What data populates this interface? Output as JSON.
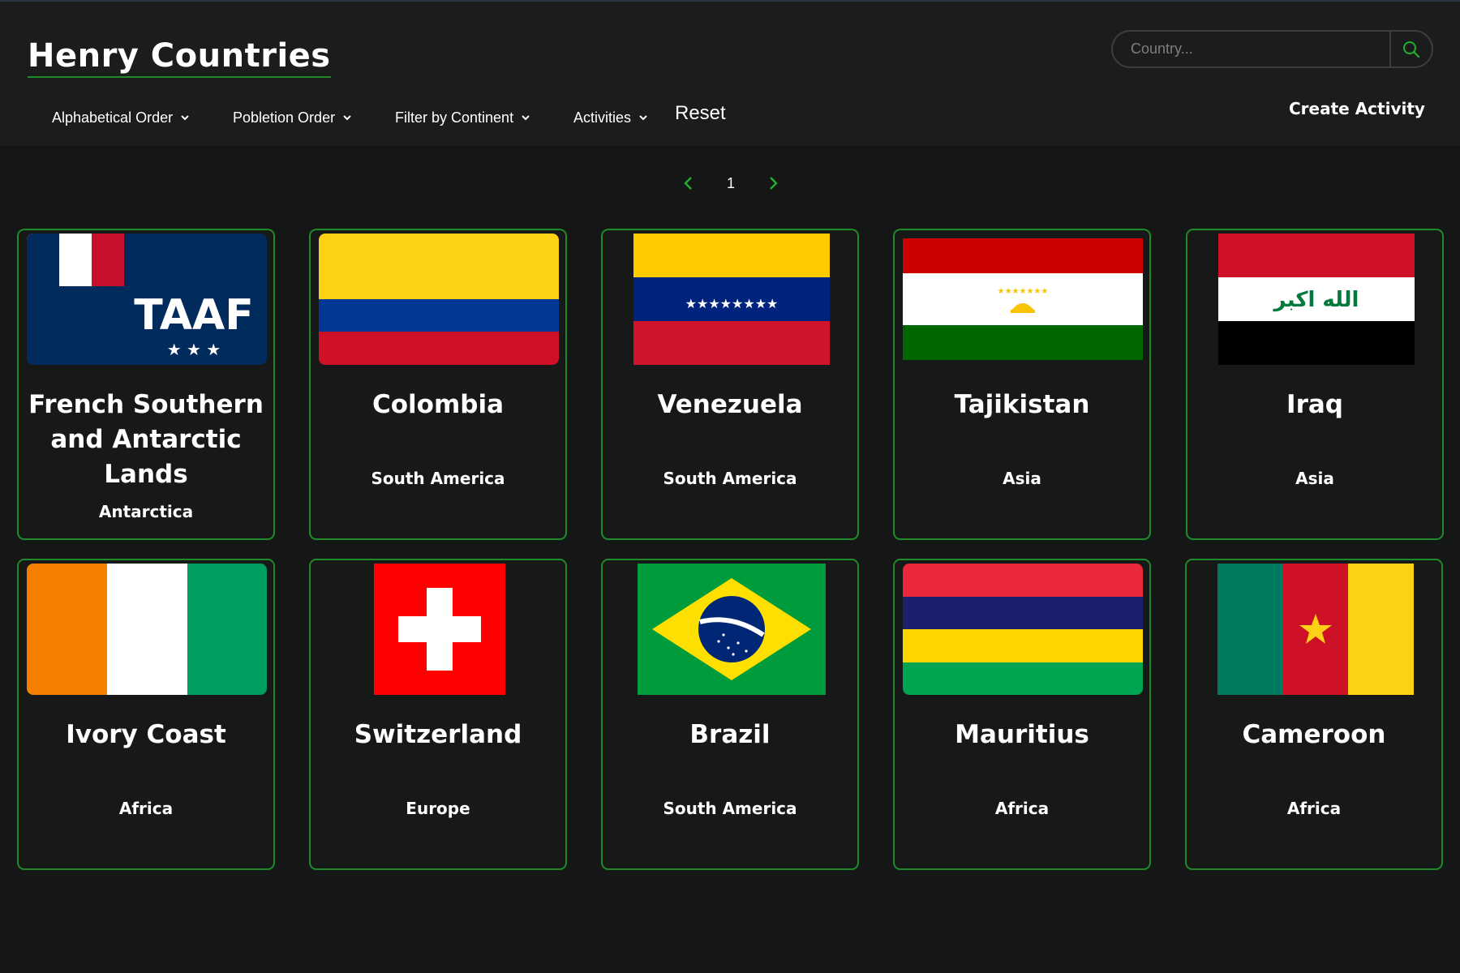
{
  "header": {
    "title": "Henry Countries",
    "nav": [
      {
        "label": "Alphabetical Order"
      },
      {
        "label": "Pobletion Order"
      },
      {
        "label": "Filter by Continent"
      },
      {
        "label": "Activities"
      }
    ],
    "reset_label": "Reset",
    "create_label": "Create Activity",
    "search": {
      "placeholder": "Country..."
    }
  },
  "pagination": {
    "current": "1"
  },
  "colors": {
    "accent": "#1f8a2a",
    "background": "#151716",
    "header": "#1b1c1c"
  },
  "countries": [
    {
      "name_lines": [
        "French Southern",
        "and Antarctic Lands"
      ],
      "continent": "Antarctica"
    },
    {
      "name_lines": [
        "Colombia"
      ],
      "continent": "South America"
    },
    {
      "name_lines": [
        "Venezuela"
      ],
      "continent": "South America"
    },
    {
      "name_lines": [
        "Tajikistan"
      ],
      "continent": "Asia"
    },
    {
      "name_lines": [
        "Iraq"
      ],
      "continent": "Asia"
    },
    {
      "name_lines": [
        "Ivory Coast"
      ],
      "continent": "Africa"
    },
    {
      "name_lines": [
        "Switzerland"
      ],
      "continent": "Europe"
    },
    {
      "name_lines": [
        "Brazil"
      ],
      "continent": "South America"
    },
    {
      "name_lines": [
        "Mauritius"
      ],
      "continent": "Africa"
    },
    {
      "name_lines": [
        "Cameroon"
      ],
      "continent": "Africa"
    }
  ],
  "flag_texts": {
    "iraq": "الله اكبر"
  }
}
